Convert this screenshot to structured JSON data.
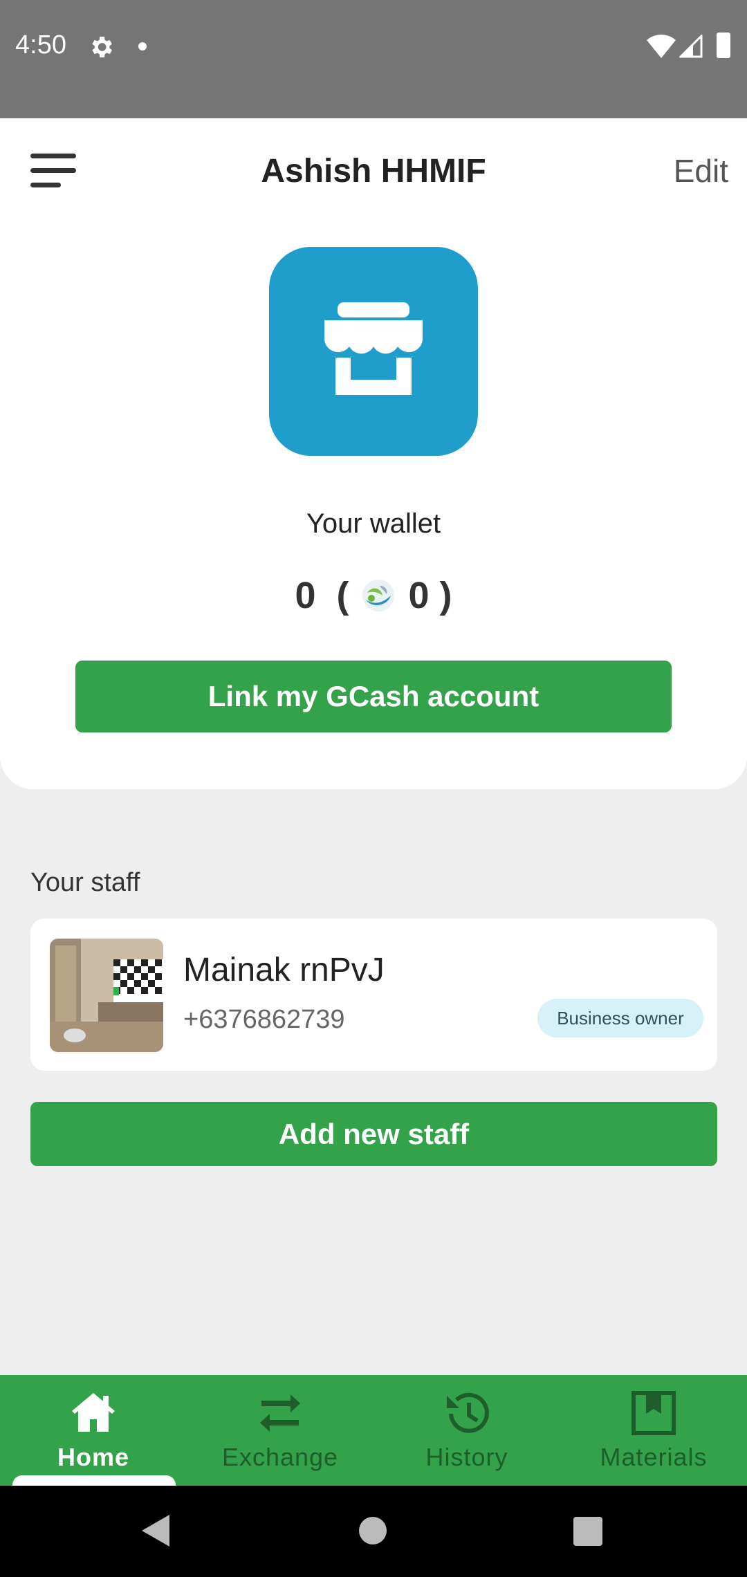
{
  "status_bar": {
    "time": "4:50"
  },
  "header": {
    "title": "Ashish HHMIF",
    "edit_label": "Edit"
  },
  "wallet": {
    "label": "Your wallet",
    "balance": "0",
    "points": "0",
    "link_button": "Link my GCash account"
  },
  "staff": {
    "heading": "Your staff",
    "members": [
      {
        "name": "Mainak rnPvJ",
        "phone": "+6376862739",
        "role": "Business owner"
      }
    ],
    "add_button": "Add new staff"
  },
  "bottom_nav": {
    "items": [
      {
        "label": "Home",
        "icon": "home-icon",
        "active": true
      },
      {
        "label": "Exchange",
        "icon": "exchange-icon",
        "active": false
      },
      {
        "label": "History",
        "icon": "history-icon",
        "active": false
      },
      {
        "label": "Materials",
        "icon": "bookmark-box-icon",
        "active": false
      }
    ]
  },
  "colors": {
    "accent_green": "#34a24a",
    "store_blue": "#1f9ecb",
    "status_bar": "#757575",
    "badge_bg": "#d6f1f8"
  }
}
